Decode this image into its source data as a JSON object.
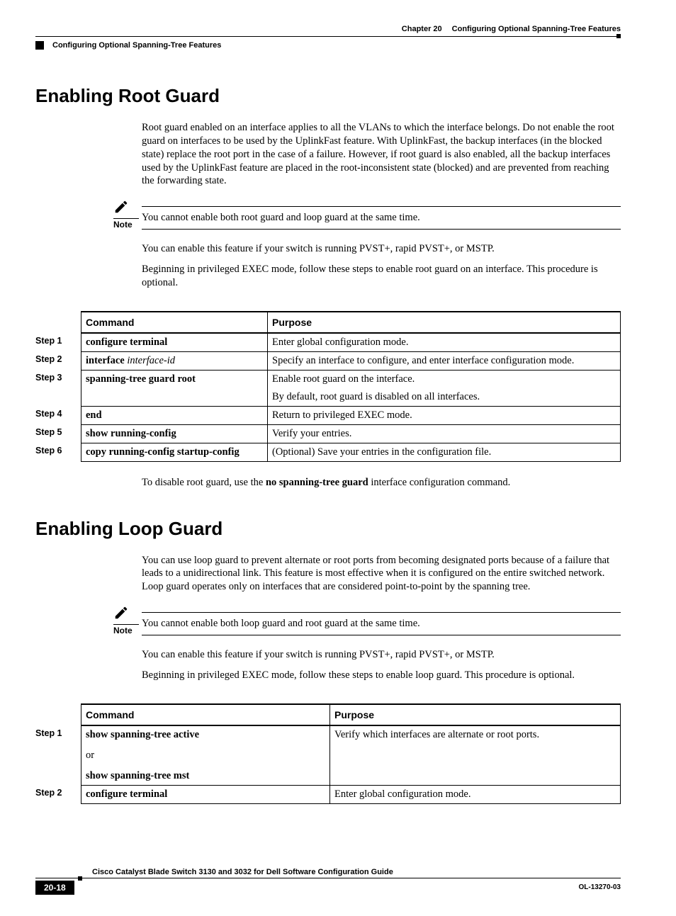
{
  "header": {
    "chapter_label": "Chapter 20",
    "chapter_title": "Configuring Optional Spanning-Tree Features",
    "section_running": "Configuring Optional Spanning-Tree Features"
  },
  "section1": {
    "title": "Enabling Root Guard",
    "para1": "Root guard enabled on an interface applies to all the VLANs to which the interface belongs. Do not enable the root guard on interfaces to be used by the UplinkFast feature. With UplinkFast, the backup interfaces (in the blocked state) replace the root port in the case of a failure. However, if root guard is also enabled, all the backup interfaces used by the UplinkFast feature are placed in the root-inconsistent state (blocked) and are prevented from reaching the forwarding state.",
    "note_label": "Note",
    "note_text": "You cannot enable both root guard and loop guard at the same time.",
    "para2": "You can enable this feature if your switch is running PVST+, rapid PVST+, or MSTP.",
    "para3": "Beginning in privileged EXEC mode, follow these steps to enable root guard on an interface. This procedure is optional.",
    "table": {
      "h1": "Command",
      "h2": "Purpose",
      "rows": [
        {
          "step": "Step 1",
          "cmd": "configure terminal",
          "cmd_italic": "",
          "purp": "Enter global configuration mode."
        },
        {
          "step": "Step 2",
          "cmd": "interface ",
          "cmd_italic": "interface-id",
          "purp": "Specify an interface to configure, and enter interface configuration mode."
        },
        {
          "step": "Step 3",
          "cmd": "spanning-tree guard root",
          "cmd_italic": "",
          "purp": "Enable root guard on the interface.",
          "purp2": "By default, root guard is disabled on all interfaces."
        },
        {
          "step": "Step 4",
          "cmd": "end",
          "cmd_italic": "",
          "purp": "Return to privileged EXEC mode."
        },
        {
          "step": "Step 5",
          "cmd": "show running-config",
          "cmd_italic": "",
          "purp": "Verify your entries."
        },
        {
          "step": "Step 6",
          "cmd": "copy running-config startup-config",
          "cmd_italic": "",
          "purp": "(Optional) Save your entries in the configuration file."
        }
      ]
    },
    "post_pre": "To disable root guard, use the ",
    "post_bold": "no spanning-tree guard",
    "post_post": " interface configuration command."
  },
  "section2": {
    "title": "Enabling Loop Guard",
    "para1": "You can use loop guard to prevent alternate or root ports from becoming designated ports because of a failure that leads to a unidirectional link. This feature is most effective when it is configured on the entire switched network. Loop guard operates only on interfaces that are considered point-to-point by the spanning tree.",
    "note_label": "Note",
    "note_text": "You cannot enable both loop guard and root guard at the same time.",
    "para2": "You can enable this feature if your switch is running PVST+, rapid PVST+, or MSTP.",
    "para3": "Beginning in privileged EXEC mode, follow these steps to enable loop guard. This procedure is optional.",
    "table": {
      "h1": "Command",
      "h2": "Purpose",
      "rows": [
        {
          "step": "Step 1",
          "cmd1": "show spanning-tree active",
          "or": "or",
          "cmd2": "show spanning-tree mst",
          "purp": "Verify which interfaces are alternate or root ports."
        },
        {
          "step": "Step 2",
          "cmd1": "configure terminal",
          "or": "",
          "cmd2": "",
          "purp": "Enter global configuration mode."
        }
      ]
    }
  },
  "footer": {
    "guide_title": "Cisco Catalyst Blade Switch 3130 and 3032 for Dell Software Configuration Guide",
    "page": "20-18",
    "docid": "OL-13270-03"
  }
}
